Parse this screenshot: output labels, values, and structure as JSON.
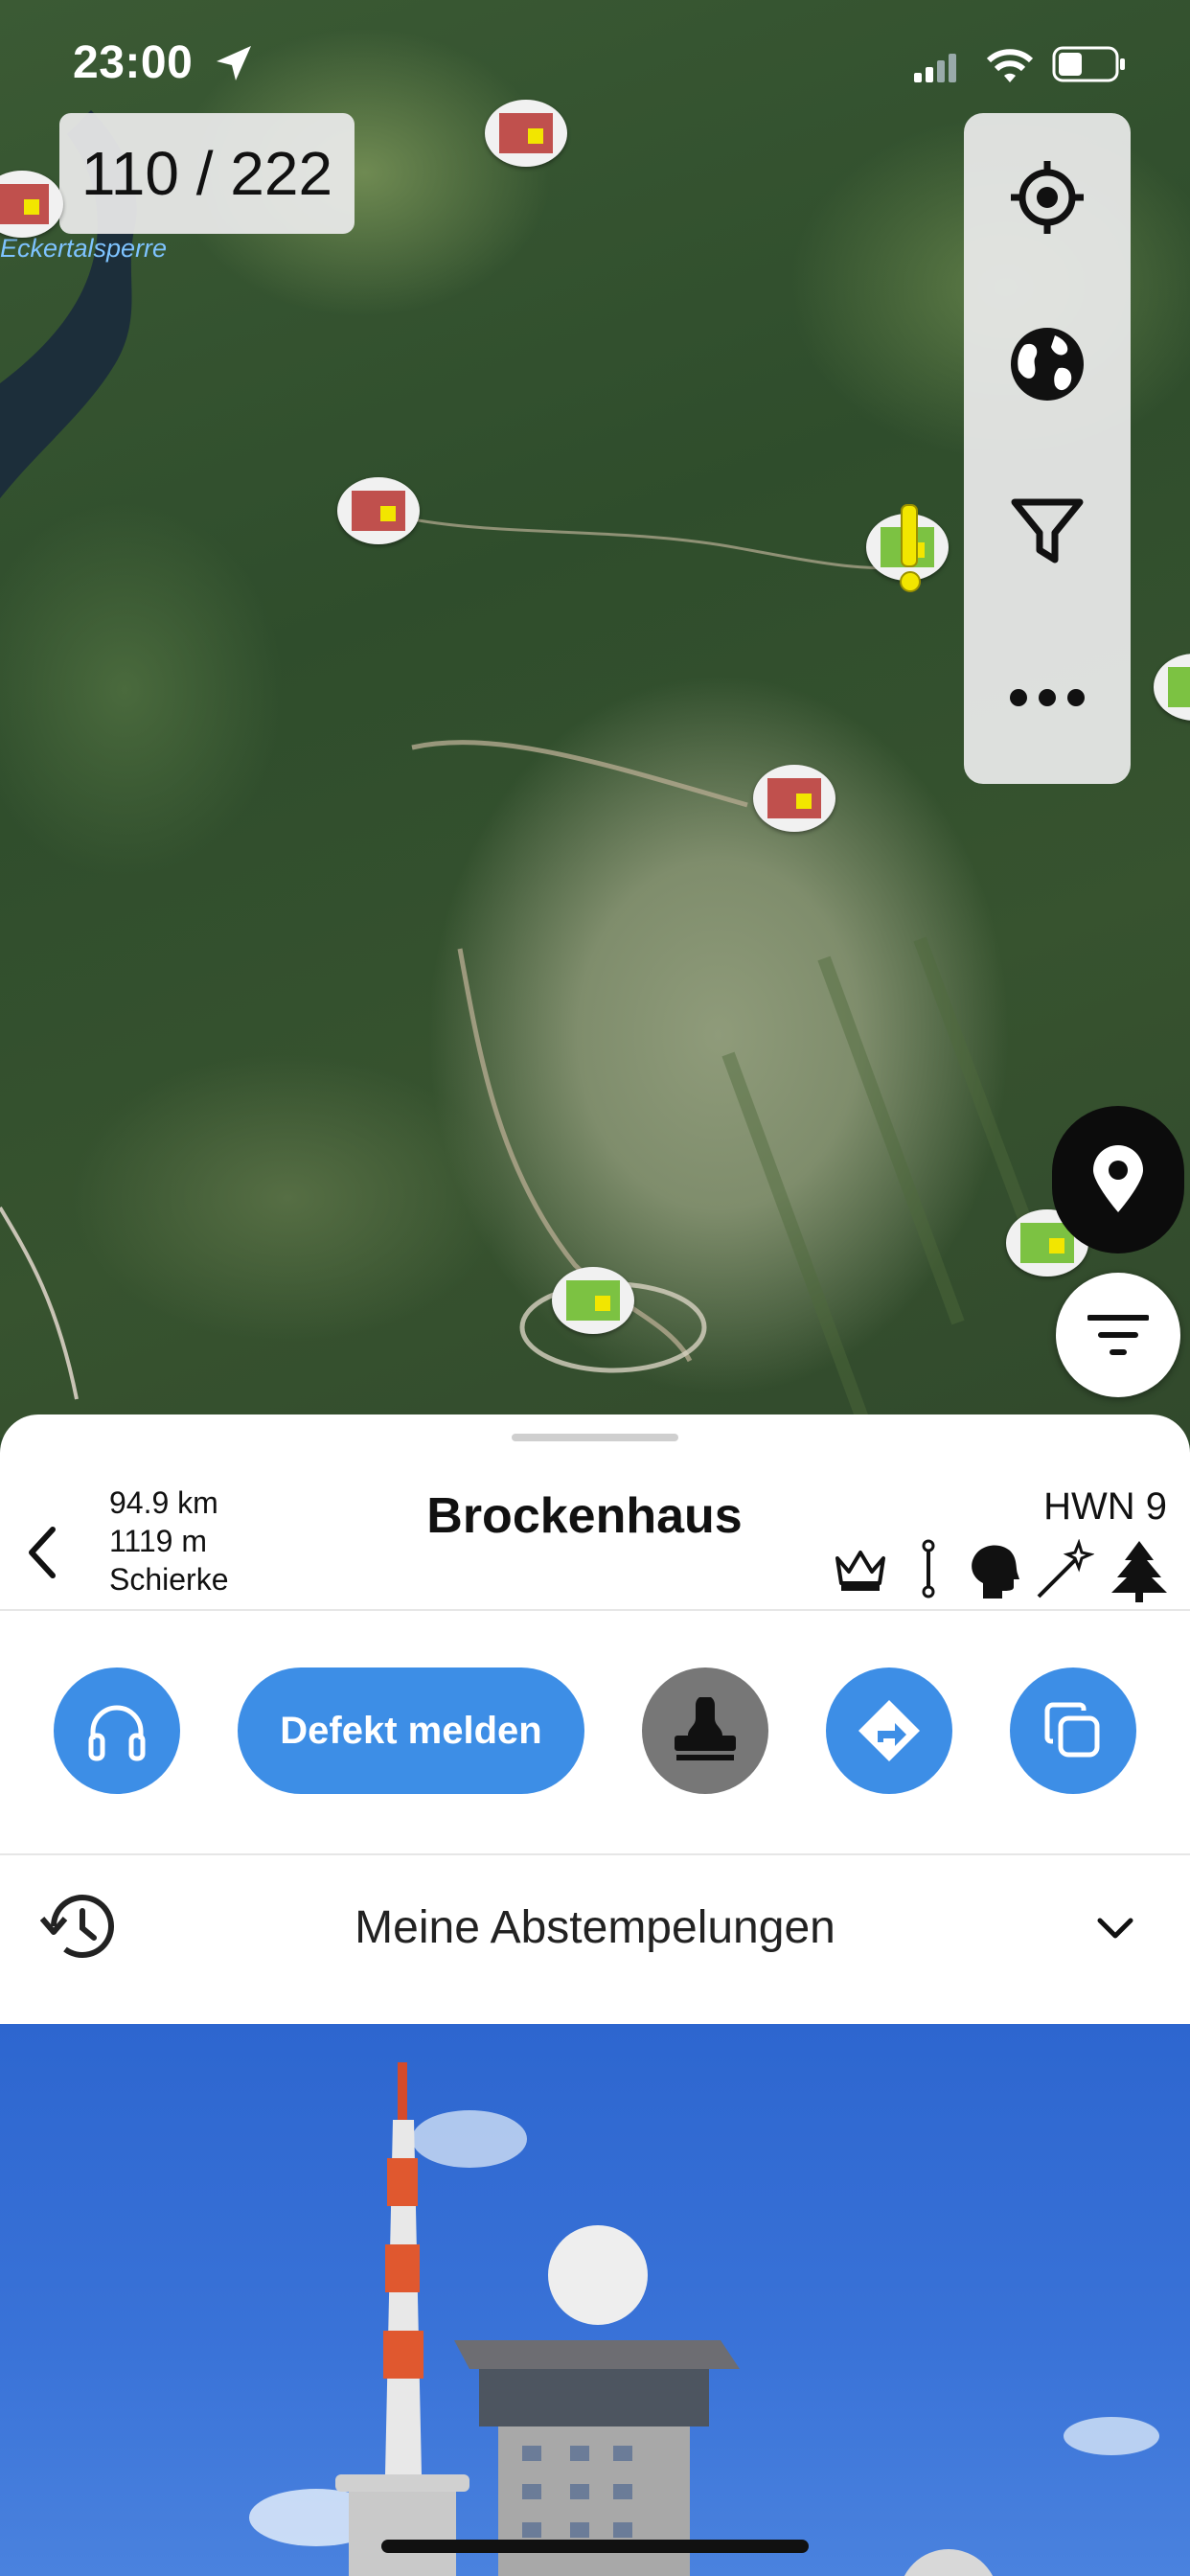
{
  "status_bar": {
    "time": "23:00"
  },
  "map": {
    "counter": "110 / 222",
    "place_label": "Eckertalsperre",
    "controls": [
      "locate-icon",
      "globe-icon",
      "filter-icon",
      "more-icon"
    ],
    "marker_colors": {
      "visited": "#c0504d",
      "unvisited": "#7cc242",
      "alert": "#f2e600"
    }
  },
  "sheet": {
    "stats": {
      "distance": "94.9 km",
      "elevation": "1119 m",
      "town": "Schierke"
    },
    "title": "Brockenhaus",
    "code": "HWN 9",
    "attribute_icons": [
      "crown-icon",
      "pin-icon",
      "head-icon",
      "magic-wand-icon",
      "tree-icon"
    ],
    "actions": {
      "audio": "headphones-icon",
      "report_label": "Defekt melden",
      "stamp": "stamp-icon",
      "directions": "directions-icon",
      "copy": "copy-icon"
    },
    "history_label": "Meine Abstempelungen"
  },
  "colors": {
    "accent": "#3d8ee6",
    "stamp_button": "#777777"
  }
}
